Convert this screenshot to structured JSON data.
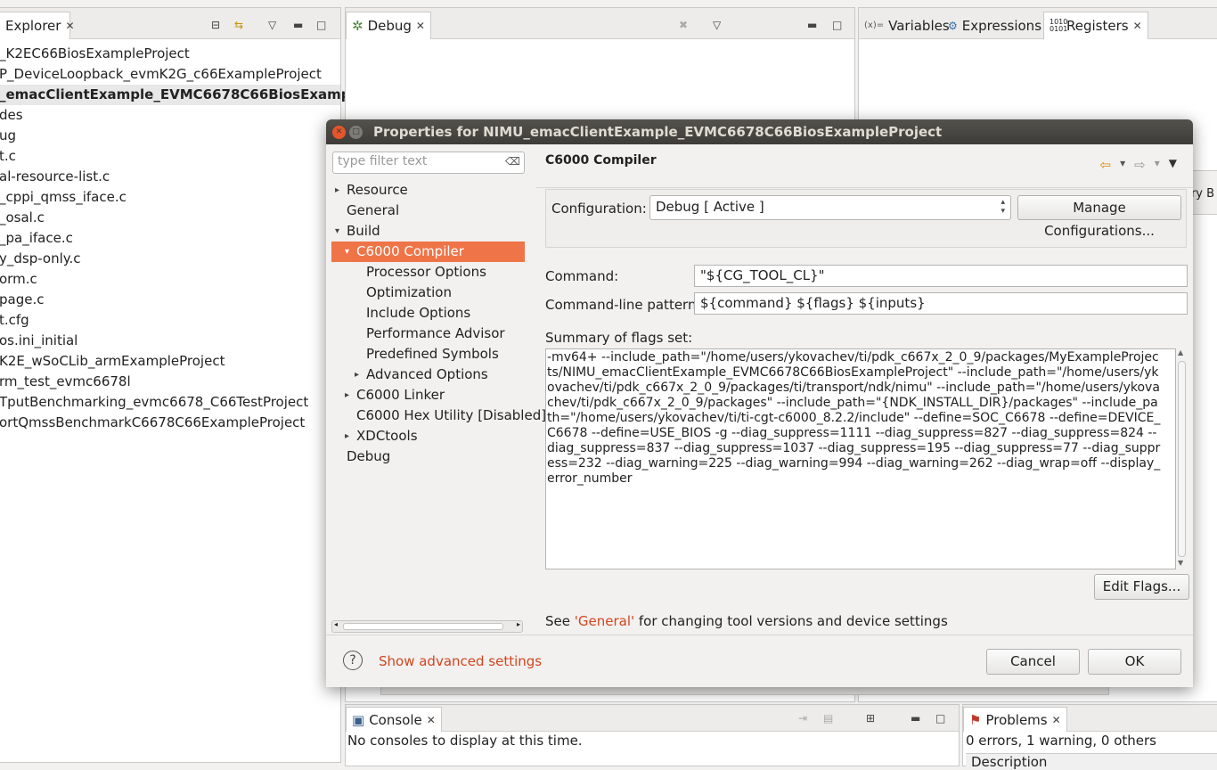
{
  "explorer": {
    "tab_label": "Explorer",
    "items": [
      "_K2EC66BiosExampleProject",
      "P_DeviceLoopback_evmK2G_c66ExampleProject",
      "_emacClientExample_EVMC6678C66BiosExampleProj",
      "des",
      "ug",
      "t.c",
      "al-resource-list.c",
      "_cppi_qmss_iface.c",
      "_osal.c",
      "_pa_iface.c",
      "y_dsp-only.c",
      "orm.c",
      "page.c",
      "t.cfg",
      "os.ini_initial",
      "K2E_wSoCLib_armExampleProject",
      "rm_test_evmc6678l",
      "TputBenchmarking_evmc6678_C66TestProject",
      "ortQmssBenchmarkC6678C66ExampleProject"
    ]
  },
  "debug_view": {
    "tab_label": "Debug"
  },
  "vars_view": {
    "tabs": [
      "Variables",
      "Expressions",
      "Registers"
    ],
    "partial_text": "ory B"
  },
  "console_view": {
    "tab_label": "Console",
    "message": "No consoles to display at this time."
  },
  "problems_view": {
    "tab_label": "Problems",
    "summary": "0 errors, 1 warning, 0 others",
    "column": "Description"
  },
  "dialog": {
    "title": "Properties for NIMU_emacClientExample_EVMC6678C66BiosExampleProject",
    "filter_placeholder": "type filter text",
    "tree": [
      "Resource",
      "General",
      "Build",
      "C6000 Compiler",
      "Processor Options",
      "Optimization",
      "Include Options",
      "Performance Advisor",
      "Predefined Symbols",
      "Advanced Options",
      "C6000 Linker",
      "C6000 Hex Utility  [Disabled]",
      "XDCtools",
      "Debug"
    ],
    "page_title": "C6000 Compiler",
    "configuration_label": "Configuration:",
    "configuration_value": "Debug  [ Active ]",
    "manage_button": "Manage Configurations...",
    "command_label": "Command:",
    "command_value": "\"${CG_TOOL_CL}\"",
    "pattern_label": "Command-line pattern:",
    "pattern_value": "${command} ${flags} ${inputs}",
    "summary_label": "Summary of flags set:",
    "summary_text": "-mv64+ --include_path=\"/home/users/ykovachev/ti/pdk_c667x_2_0_9/packages/MyExampleProjects/NIMU_emacClientExample_EVMC6678C66BiosExampleProject\" --include_path=\"/home/users/ykovachev/ti/pdk_c667x_2_0_9/packages/ti/transport/ndk/nimu\" --include_path=\"/home/users/ykovachev/ti/pdk_c667x_2_0_9/packages\" --include_path=\"{NDK_INSTALL_DIR}/packages\" --include_path=\"/home/users/ykovachev/ti/ti-cgt-c6000_8.2.2/include\" --define=SOC_C6678 --define=DEVICE_C6678 --define=USE_BIOS -g --diag_suppress=1111 --diag_suppress=827 --diag_suppress=824 --diag_suppress=837 --diag_suppress=1037 --diag_suppress=195 --diag_suppress=77 --diag_suppress=232 --diag_warning=225 --diag_warning=994 --diag_warning=262 --diag_wrap=off --display_error_number",
    "edit_flags_button": "Edit Flags...",
    "note_prefix": "See ",
    "note_link": "'General'",
    "note_suffix": " for changing tool versions and device settings",
    "advanced_link": "Show advanced settings",
    "cancel_button": "Cancel",
    "ok_button": "OK",
    "help_glyph": "?"
  },
  "colors": {
    "selection": "#ef7447",
    "link": "#d2451e",
    "titlebar": "#3d3c38"
  }
}
